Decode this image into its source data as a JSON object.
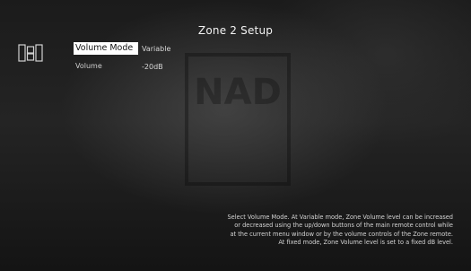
{
  "screen": {
    "title": "Zone 2 Setup"
  },
  "icons": {
    "zone": "zone-speakers-icon",
    "watermark": "nad-logo-watermark"
  },
  "menu": {
    "rows": [
      {
        "label": "Volume Mode",
        "value": "Variable",
        "selected": true
      },
      {
        "label": "Volume",
        "value": "-20dB",
        "selected": false
      }
    ]
  },
  "help": {
    "lines": [
      "Select Volume Mode.  At Variable mode, Zone Volume level can be increased",
      "or decreased using the up/down buttons of the main remote control while",
      "at the current menu window or by the volume controls of the Zone remote.",
      "At fixed mode, Zone Volume level is set to a fixed dB level."
    ]
  },
  "watermark_text": "NAD",
  "colors": {
    "selected_bg": "#ffffff",
    "selected_text": "#111111",
    "text": "#e6e6e6"
  }
}
